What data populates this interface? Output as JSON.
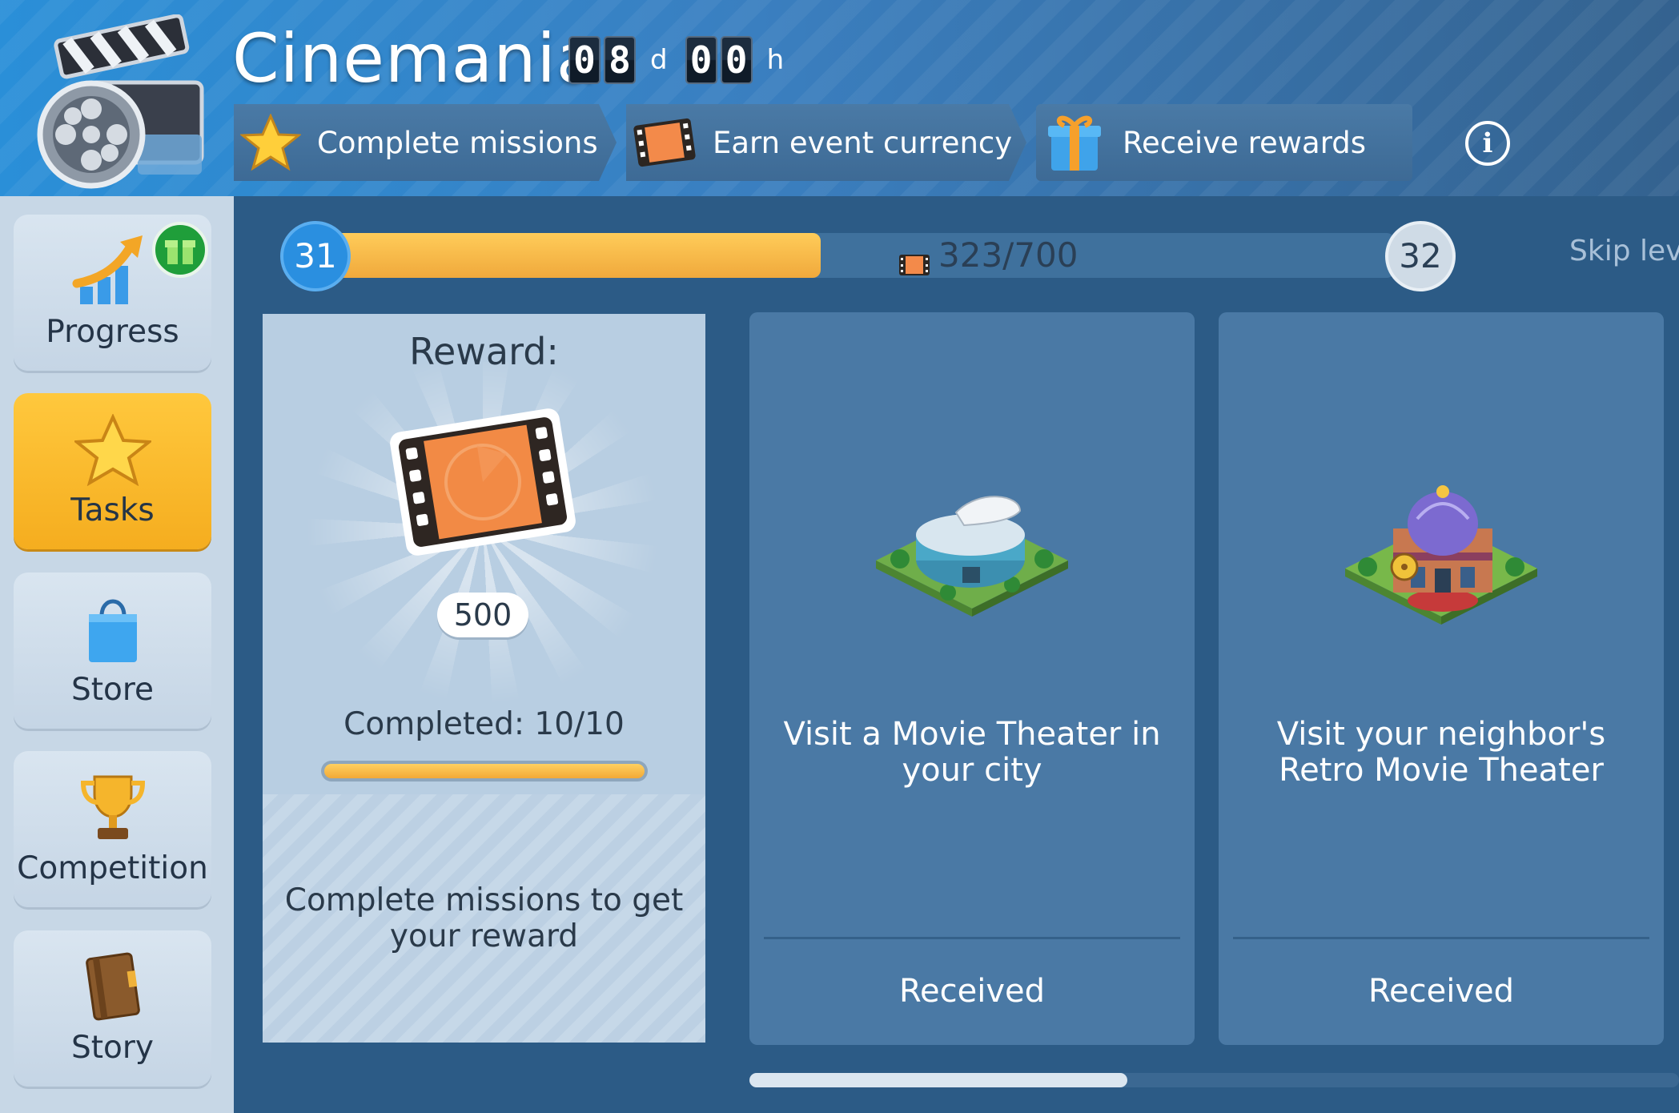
{
  "header": {
    "title": "Cinemania",
    "timer": {
      "days": "08",
      "day_unit": "d",
      "hours": "00",
      "hour_unit": "h"
    },
    "steps": [
      {
        "label": "Complete missions",
        "icon": "star-icon"
      },
      {
        "label": "Earn event currency",
        "icon": "film-icon"
      },
      {
        "label": "Receive rewards",
        "icon": "gift-icon"
      }
    ],
    "info_label": "i"
  },
  "sidebar": {
    "items": [
      {
        "label": "Progress",
        "icon": "progress-icon"
      },
      {
        "label": "Tasks",
        "icon": "star-icon",
        "active": true
      },
      {
        "label": "Store",
        "icon": "shopping-bag-icon"
      },
      {
        "label": "Competition",
        "icon": "trophy-icon"
      },
      {
        "label": "Story",
        "icon": "book-icon"
      }
    ]
  },
  "progress": {
    "current_level": "31",
    "next_level": "32",
    "value_text": "323/700",
    "fraction": 0.461,
    "skip_label": "Skip lev"
  },
  "reward": {
    "title": "Reward:",
    "amount": "500",
    "completed_text": "Completed: 10/10",
    "completed_fraction": 1.0,
    "description": "Complete missions to get your reward"
  },
  "tasks": [
    {
      "text": "Visit a Movie Theater in your city",
      "status": "Received"
    },
    {
      "text": "Visit your neighbor's Retro Movie Theater",
      "status": "Received"
    }
  ],
  "colors": {
    "accent_orange": "#f0a93c",
    "active_tab": "#ffc83d",
    "level_blue": "#2a8fe0"
  }
}
